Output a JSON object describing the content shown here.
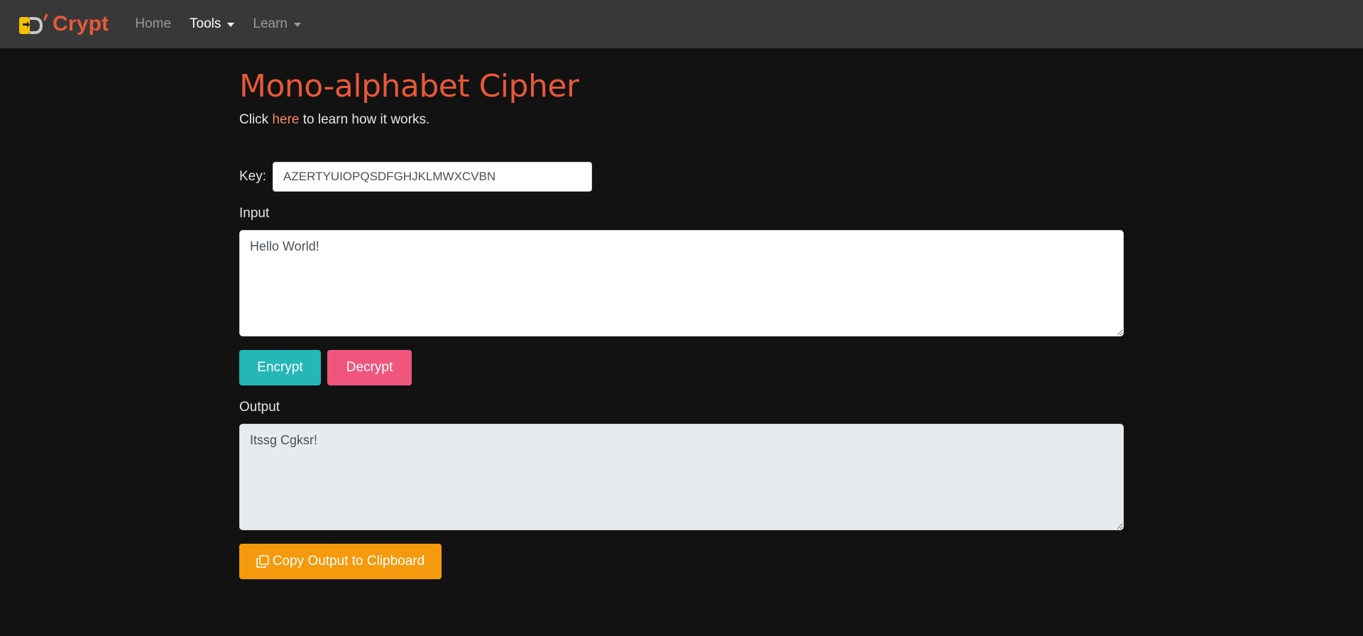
{
  "nav": {
    "brand_text": "Crypt",
    "items": [
      {
        "label": "Home"
      },
      {
        "label": "Tools"
      },
      {
        "label": "Learn"
      }
    ]
  },
  "page": {
    "title": "Mono-alphabet Cipher",
    "lead_prefix": "Click ",
    "lead_link": "here",
    "lead_suffix": " to learn how it works."
  },
  "form": {
    "key_label": "Key:",
    "key_value": "AZERTYUIOPQSDFGHJKLMWXCVBN",
    "input_label": "Input",
    "input_value": "Hello World!",
    "encrypt_label": "Encrypt",
    "decrypt_label": "Decrypt",
    "output_label": "Output",
    "output_value": "Itssg Cgksr!",
    "copy_label": "Copy Output to Clipboard"
  },
  "colors": {
    "accent": "#e8583a",
    "navbar": "#383838",
    "background": "#121212",
    "encrypt": "#25b6b6",
    "decrypt": "#ee567e",
    "copy": "#f59a0c"
  },
  "icons": {
    "logo": "padlock-d-logo",
    "copy": "copy-icon"
  }
}
